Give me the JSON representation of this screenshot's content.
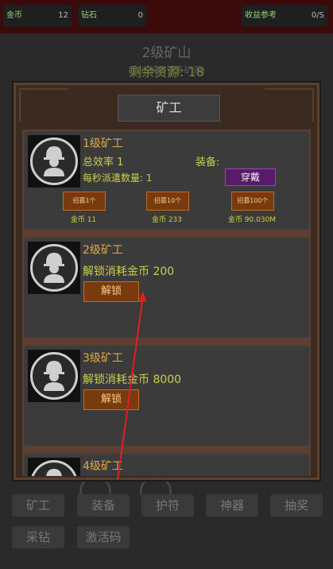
{
  "topbar": {
    "gold_label": "金币",
    "gold_value": "12",
    "diamond_label": "钻石",
    "diamond_value": "0",
    "income_label": "收益参考",
    "income_value": "0/S"
  },
  "header": {
    "title": "2级矿山",
    "subtitle": "(点击解锁更多矿洞)",
    "remaining": "剩余资源: 18"
  },
  "panel": {
    "title": "矿工",
    "cards": [
      {
        "title": "1级矿工",
        "efficiency": "总效率 1",
        "equip_label": "装备:",
        "dispatch": "每秒派遣数量: 1",
        "equip_button": "穿戴",
        "recruit": [
          {
            "label": "招募1个",
            "cost": "金币 11"
          },
          {
            "label": "招募10个",
            "cost": "金币 233"
          },
          {
            "label": "招募100个",
            "cost": "金币 90.030M"
          }
        ]
      },
      {
        "title": "2级矿工",
        "unlock_text": "解锁消耗金币 200",
        "unlock_button": "解锁"
      },
      {
        "title": "3级矿工",
        "unlock_text": "解锁消耗金币 8000",
        "unlock_button": "解锁"
      },
      {
        "title": "4级矿工"
      }
    ]
  },
  "nav": {
    "row1": [
      "矿工",
      "装备",
      "护符",
      "神器",
      "抽奖"
    ],
    "row2": [
      "采钻",
      "激活码"
    ]
  },
  "colors": {
    "accent_gold": "#e0a848",
    "text_yellow": "#c8d04a",
    "annotation_arrow": "#e02020"
  }
}
